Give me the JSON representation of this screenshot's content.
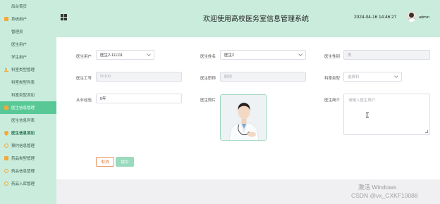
{
  "sidebar": {
    "items": [
      {
        "label": "后台首页",
        "icon": "none"
      },
      {
        "label": "系统用户",
        "icon": "folder-icon"
      },
      {
        "label": "管理员",
        "icon": "none"
      },
      {
        "label": "医生用户",
        "icon": "none"
      },
      {
        "label": "学生用户",
        "icon": "none"
      },
      {
        "label": "科室类型管理",
        "icon": "bar-chart-icon"
      },
      {
        "label": "科室类型列表",
        "icon": "none"
      },
      {
        "label": "科室类型添加",
        "icon": "none"
      },
      {
        "label": "医生信息管理",
        "icon": "folder-icon"
      },
      {
        "label": "医生信息列表",
        "icon": "none"
      },
      {
        "label": "医生信息添加",
        "icon": "pin-icon"
      },
      {
        "label": "预约信息管理",
        "icon": "circle-icon"
      },
      {
        "label": "药品类型管理",
        "icon": "folder-icon"
      },
      {
        "label": "药品信息管理",
        "icon": "circle-icon"
      },
      {
        "label": "药品入库管理",
        "icon": "circle-icon"
      }
    ]
  },
  "header": {
    "title": "欢迎使用高校医务室信息管理系统",
    "datetime": "2024-04-16 14:46:27",
    "username": "admin"
  },
  "form": {
    "doctor_user_label": "医生用户",
    "doctor_user_value": "医生2-111111",
    "doctor_name_label": "医生姓名",
    "doctor_name_value": "医生2",
    "gender_label": "医生性别",
    "gender_value": "男",
    "employee_id_label": "医生工号",
    "employee_id_value": "00100",
    "title_label": "医生职称",
    "title_value": "职称",
    "dept_type_label": "科室类型",
    "dept_type_placeholder": "选择科",
    "years_label": "从业经验",
    "years_value": "5年",
    "photo_label": "医生照片",
    "intro_label": "医生简介",
    "intro_placeholder": "请输入医生简介",
    "cancel_label": "取消",
    "submit_label": "提交"
  },
  "watermark": {
    "activate": "激活 Windows",
    "csdn": "CSDN @vx_CXKF10088"
  },
  "colors": {
    "sidebar_bg": "#c9ecdd",
    "active_item": "#58c896",
    "icon_accent": "#f0a93b"
  }
}
